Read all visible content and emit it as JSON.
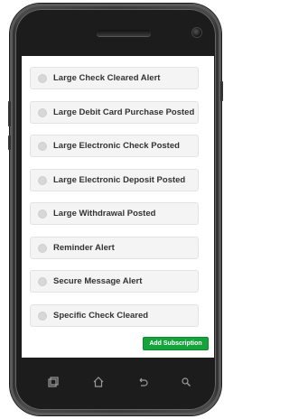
{
  "subscriptions": [
    {
      "label": "Large Check Cleared Alert"
    },
    {
      "label": "Large Debit Card Purchase Posted"
    },
    {
      "label": "Large Electronic Check Posted"
    },
    {
      "label": "Large Electronic Deposit Posted"
    },
    {
      "label": "Large Withdrawal Posted"
    },
    {
      "label": "Reminder Alert"
    },
    {
      "label": "Secure Message Alert"
    },
    {
      "label": "Specific Check Cleared"
    }
  ],
  "actions": {
    "add_subscription_label": "Add Subscription"
  },
  "colors": {
    "accent": "#15a33b",
    "device_body": "#3a3a3a",
    "item_background": "#f4f4f4"
  },
  "nav_icons": [
    "recent-apps-icon",
    "home-icon",
    "back-icon",
    "search-icon"
  ]
}
